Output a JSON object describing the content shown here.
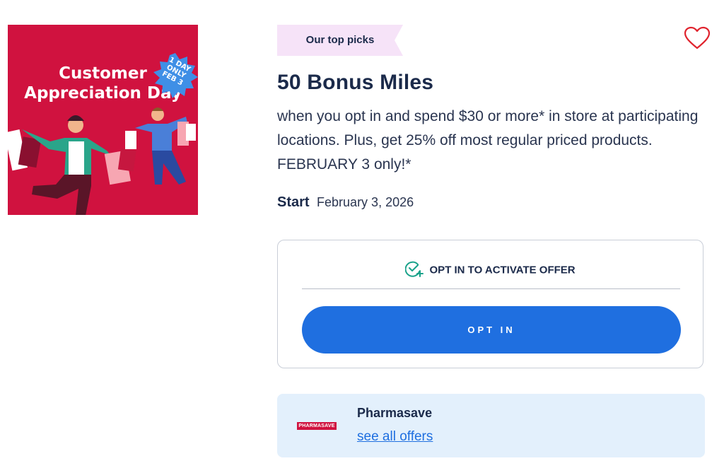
{
  "promo_image": {
    "headline_line1": "Customer",
    "headline_line2": "Appreciation Day",
    "badge_line1": "1 DAY",
    "badge_line2": "ONLY",
    "badge_line3": "FEB 3",
    "bg_color": "#d0123f"
  },
  "ribbon": {
    "label": "Our top picks"
  },
  "favorite": {
    "icon": "heart-icon",
    "color": "#e0242e"
  },
  "offer": {
    "title": "50 Bonus Miles",
    "description": "when you opt in and spend $30 or more* in store at participating locations. Plus, get 25% off most regular priced products. FEBRUARY 3 only!*",
    "start_label": "Start",
    "start_date": "February 3, 2026"
  },
  "opt_in_card": {
    "heading": "OPT IN TO ACTIVATE OFFER",
    "heading_icon": "check-plus-icon",
    "button_label": "OPT IN",
    "button_color": "#1f6fe0"
  },
  "store": {
    "logo_text": "PHARMASAVE",
    "name": "Pharmasave",
    "link": "see all offers"
  }
}
